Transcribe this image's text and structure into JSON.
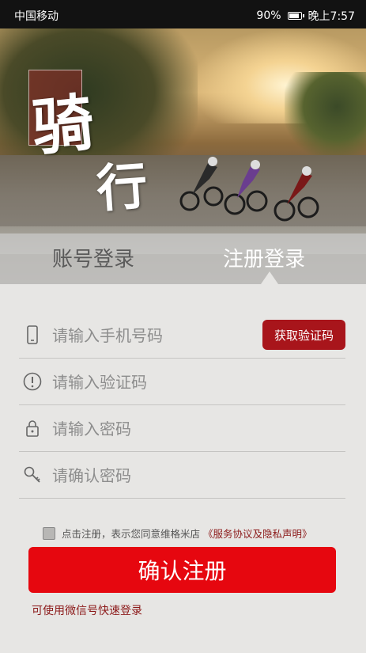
{
  "status_bar": {
    "carrier": "中国移动",
    "battery": "90%",
    "time": "晚上7:57"
  },
  "hero": {
    "logo_char_1": "骑",
    "logo_char_2": "行"
  },
  "tabs": {
    "login_label": "账号登录",
    "register_label": "注册登录",
    "active": "register"
  },
  "form": {
    "phone": {
      "placeholder": "请输入手机号码",
      "value": ""
    },
    "get_code_label": "获取验证码",
    "code": {
      "placeholder": "请输入验证码",
      "value": ""
    },
    "password": {
      "placeholder": "请输入密码",
      "value": ""
    },
    "confirm_password": {
      "placeholder": "请确认密码",
      "value": ""
    },
    "agreement_text": "点击注册，表示您同意维格米店",
    "agreement_link": "《服务协议及隐私声明》",
    "submit_label": "确认注册",
    "wechat_login": "可使用微信号快速登录"
  },
  "colors": {
    "accent_red": "#e6070f",
    "dark_red": "#a8151b",
    "link_red": "#8c1a1a",
    "background": "#e7e6e4"
  }
}
